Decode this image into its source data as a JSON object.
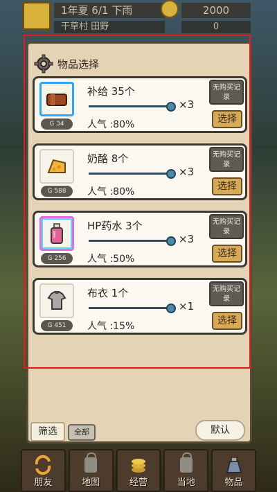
{
  "hud": {
    "date": "1年夏 6/1 下雨",
    "money": "2000",
    "location": "干草村 田野",
    "count": "0"
  },
  "panel": {
    "title": "物品选择",
    "items": [
      {
        "name": "补给 35个",
        "price": "G 34",
        "popularity": "人气 :80%",
        "multiplier": "×3",
        "no_history": "无购买记录",
        "choose": "选择",
        "icon": "supply-crate-icon",
        "color": "#9b4a1f"
      },
      {
        "name": "奶酪 8个",
        "price": "G 588",
        "popularity": "人气 :80%",
        "multiplier": "×3",
        "no_history": "无购买记录",
        "choose": "选择",
        "icon": "cheese-icon",
        "color": "#f2b43a"
      },
      {
        "name": "HP药水 3个",
        "price": "G 256",
        "popularity": "人气 :50%",
        "multiplier": "×3",
        "no_history": "无购买记录",
        "choose": "选择",
        "icon": "potion-icon",
        "color": "#e0639a"
      },
      {
        "name": "布衣 1个",
        "price": "G 451",
        "popularity": "人气 :15%",
        "multiplier": "×1",
        "no_history": "无购买记录",
        "choose": "选择",
        "icon": "cloth-armor-icon",
        "color": "#9c9c9c"
      }
    ],
    "filter": "筛选",
    "all": "全部",
    "default": "默认"
  },
  "nav": [
    {
      "label": "朋友",
      "icon": "friend-swap-icon",
      "locked": false
    },
    {
      "label": "地图",
      "icon": "lock-icon",
      "locked": true
    },
    {
      "label": "经营",
      "icon": "coin-stack-icon",
      "locked": false
    },
    {
      "label": "当地",
      "icon": "lock-icon",
      "locked": true
    },
    {
      "label": "物品",
      "icon": "potion-bag-icon",
      "locked": false
    }
  ]
}
